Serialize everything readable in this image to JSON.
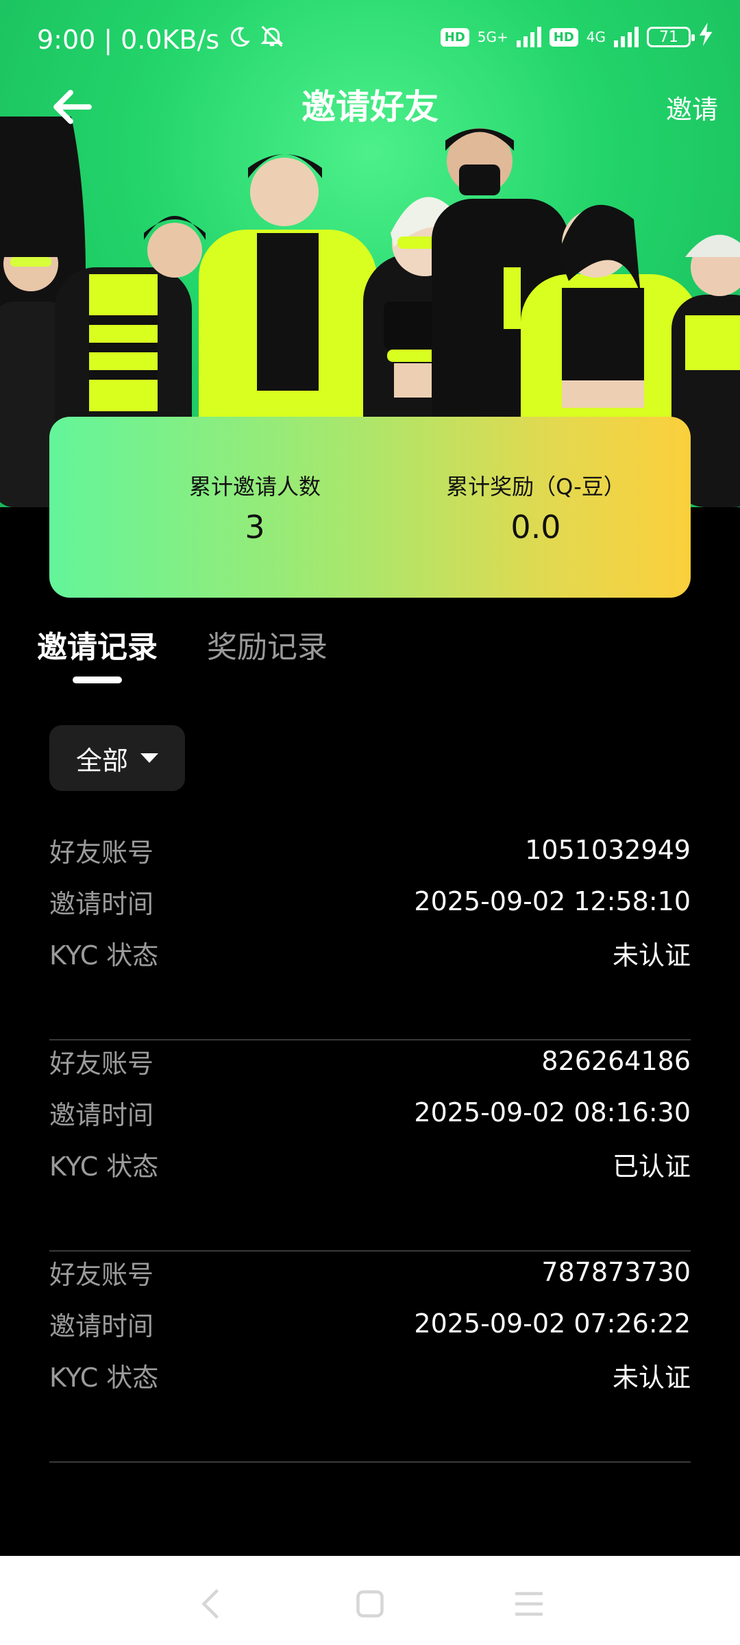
{
  "status_bar": {
    "time": "9:00",
    "network_speed": "0.0KB/s",
    "icons": [
      "moon-icon",
      "bell-off-icon"
    ],
    "hd1": "HD",
    "signal1_type": "5G+",
    "hd2": "HD",
    "signal2_type": "4G",
    "battery": "71"
  },
  "header": {
    "title": "邀请好友",
    "action": "邀请",
    "back_icon": "arrow-left-icon"
  },
  "stats": {
    "invited_label": "累计邀请人数",
    "invited_value": "3",
    "reward_label": "累计奖励（Q-豆）",
    "reward_value": "0.0"
  },
  "tabs": [
    {
      "label": "邀请记录",
      "active": true
    },
    {
      "label": "奖励记录",
      "active": false
    }
  ],
  "filter": {
    "selected": "全部"
  },
  "labels": {
    "account": "好友账号",
    "time": "邀请时间",
    "kyc": "KYC 状态"
  },
  "records": [
    {
      "account": "1051032949",
      "time": "2025-09-02 12:58:10",
      "kyc": "未认证"
    },
    {
      "account": "826264186",
      "time": "2025-09-02 08:16:30",
      "kyc": "已认证"
    },
    {
      "account": "787873730",
      "time": "2025-09-02 07:26:22",
      "kyc": "未认证"
    }
  ],
  "colors": {
    "hero_green": "#22d46a",
    "card_gradient_start": "#63f59a",
    "card_gradient_end": "#fbcf3c",
    "accent_yellow": "#e6ff2e"
  }
}
